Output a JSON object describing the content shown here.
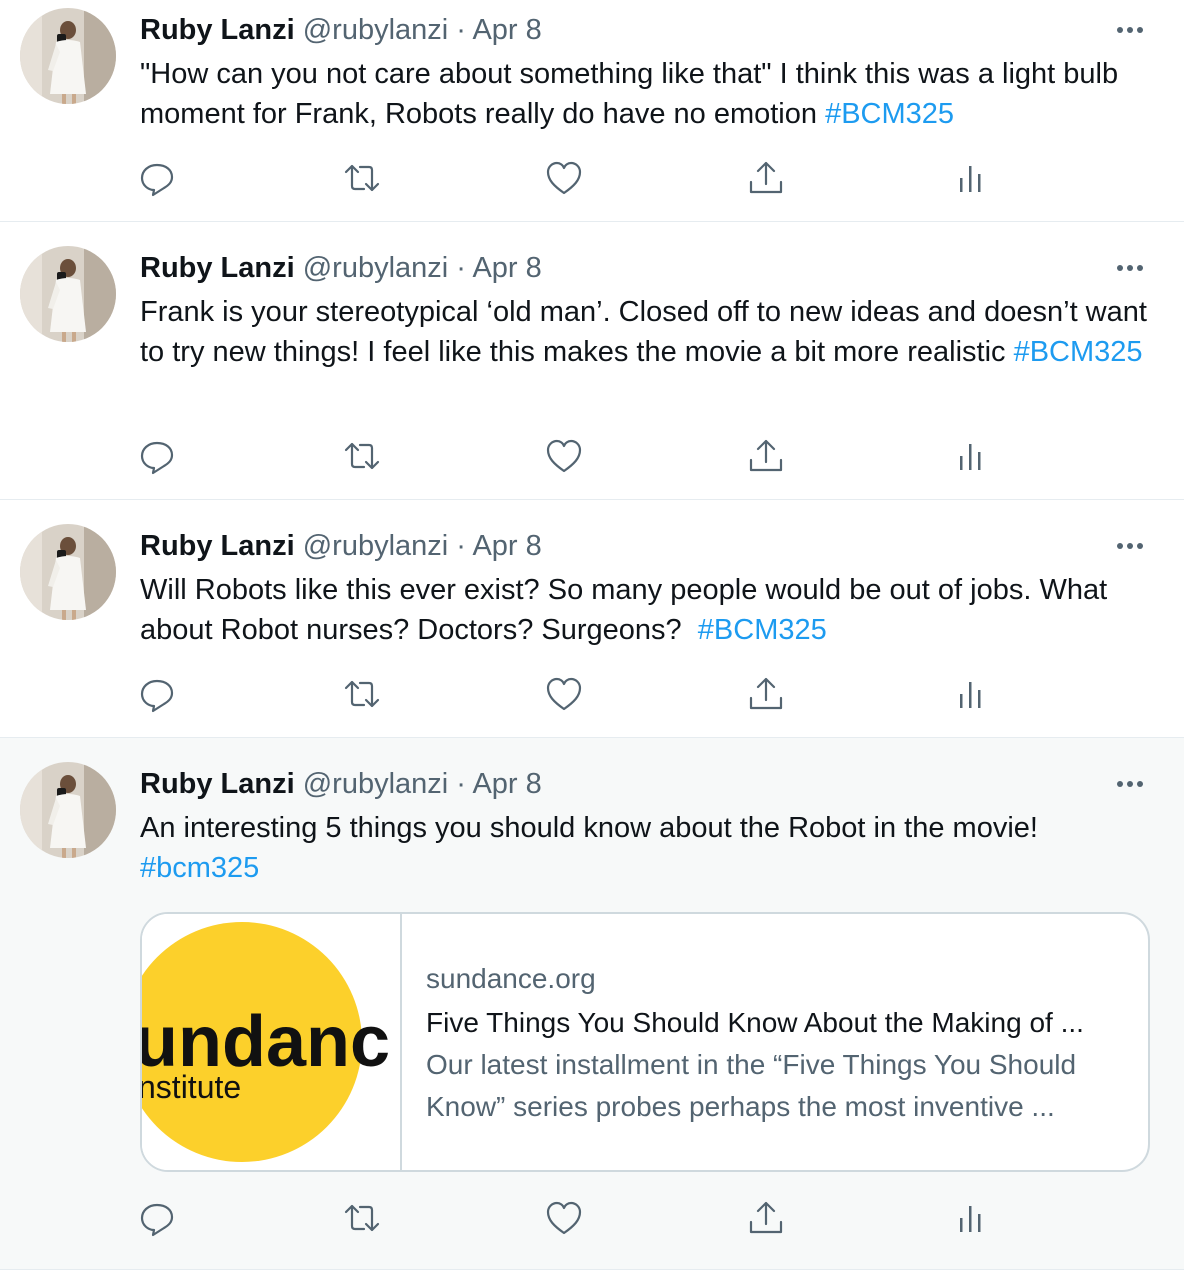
{
  "tweets": [
    {
      "name": "Ruby Lanzi",
      "handle": "@rubylanzi",
      "separator": "·",
      "date": "Apr 8",
      "text": "\"How can you not care about something like that\" I think this was a light bulb moment for Frank, Robots really do have no emotion ",
      "hashtag": "#BCM325"
    },
    {
      "name": "Ruby Lanzi",
      "handle": "@rubylanzi",
      "separator": "·",
      "date": "Apr 8",
      "text": "Frank is your stereotypical ‘old man’. Closed off to new ideas and doesn’t want to try new things! I feel like this makes the movie a bit more realistic ",
      "hashtag": "#BCM325"
    },
    {
      "name": "Ruby Lanzi",
      "handle": "@rubylanzi",
      "separator": "·",
      "date": "Apr 8",
      "text": "Will Robots like this ever exist? So many people would be out of jobs. What about Robot nurses? Doctors? Surgeons?  ",
      "hashtag": "#BCM325"
    },
    {
      "name": "Ruby Lanzi",
      "handle": "@rubylanzi",
      "separator": "·",
      "date": "Apr 8",
      "text": "An interesting 5 things you should know about the Robot in the movie! ",
      "hashtag": "#bcm325",
      "card": {
        "logo_line1": "undanc",
        "logo_line2": "nstitute",
        "domain": "sundance.org",
        "title": "Five Things You Should Know About the Making of ...",
        "description": "Our latest installment in the “Five Things You Should Know” series probes perhaps the most inventive ..."
      }
    }
  ],
  "icons": {
    "reply": "reply-icon",
    "retweet": "retweet-icon",
    "like": "like-icon",
    "share": "share-icon",
    "analytics": "analytics-icon",
    "more": "more-icon"
  },
  "colors": {
    "link": "#1d9bf0",
    "secondary_text": "#536471",
    "primary_text": "#0f1419",
    "divider": "#e6ecf0",
    "sundance_yellow": "#fcd02b"
  }
}
